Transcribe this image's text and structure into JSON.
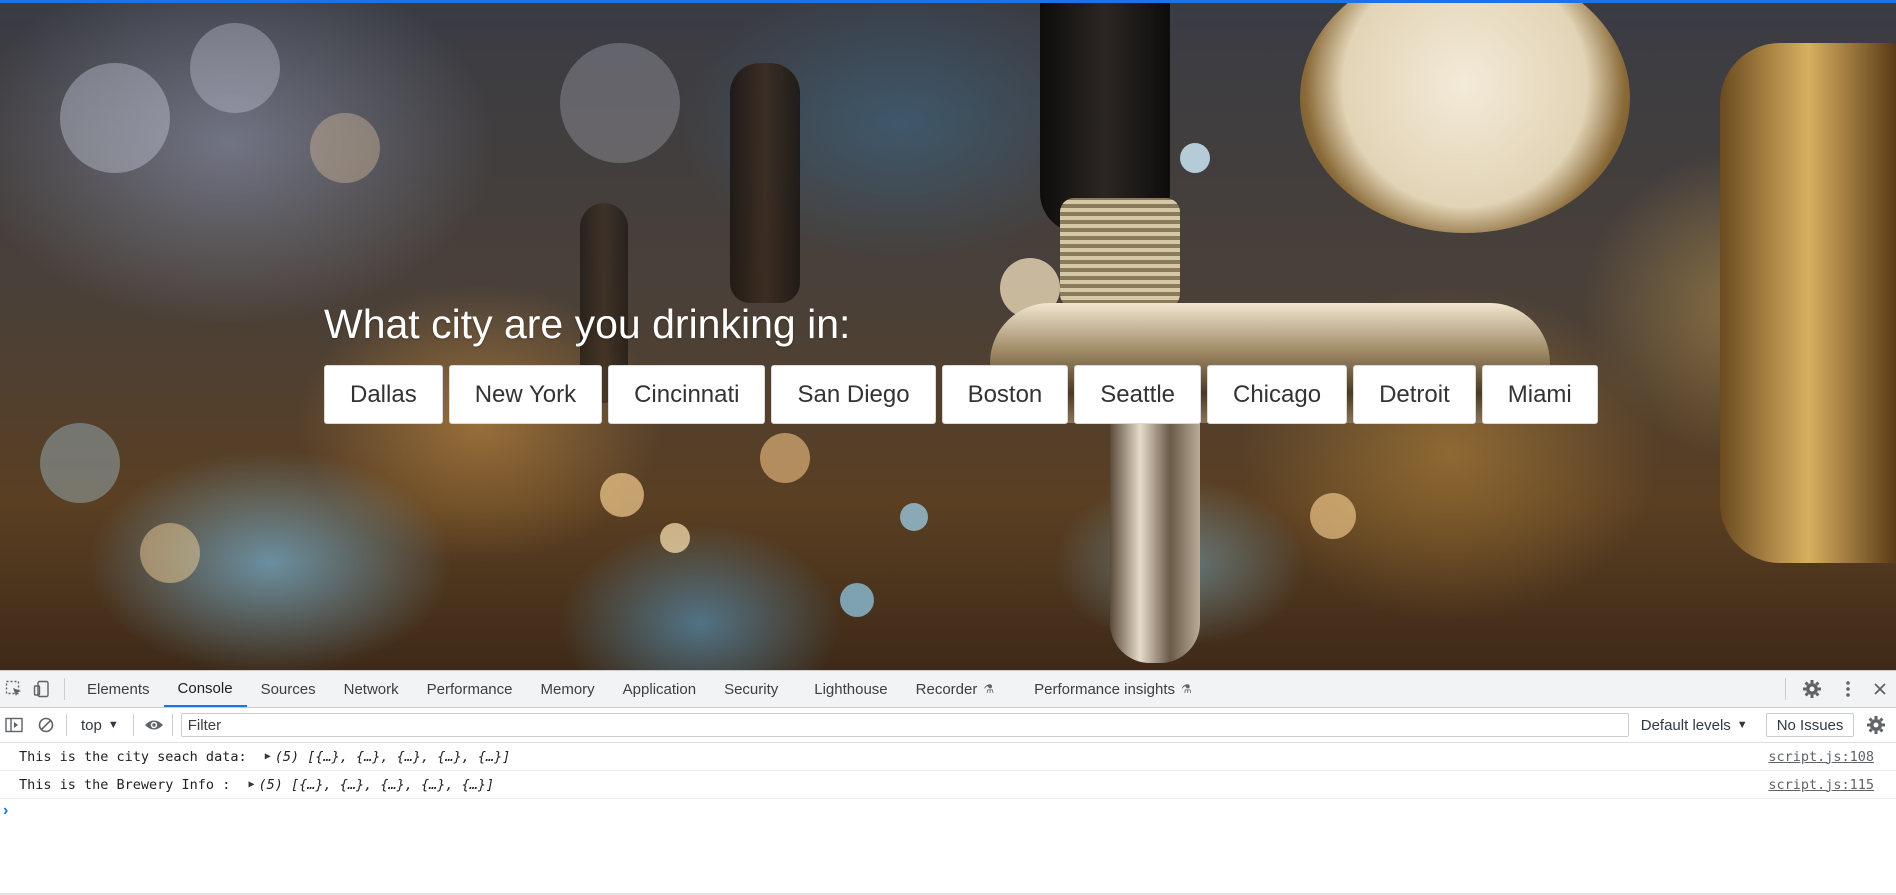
{
  "page": {
    "heading": "What city are you drinking in:",
    "cities": [
      "Dallas",
      "New York",
      "Cincinnati",
      "San Diego",
      "Boston",
      "Seattle",
      "Chicago",
      "Detroit",
      "Miami"
    ]
  },
  "devtools": {
    "tabs": [
      "Elements",
      "Console",
      "Sources",
      "Network",
      "Performance",
      "Memory",
      "Application",
      "Security",
      "Lighthouse",
      "Recorder",
      "Performance insights"
    ],
    "active_tab": "Console",
    "toolbar": {
      "context": "top",
      "filter_placeholder": "Filter",
      "levels": "Default levels",
      "issues": "No Issues"
    },
    "console": [
      {
        "message": "This is the city seach data: ",
        "value": "(5) [{…}, {…}, {…}, {…}, {…}]",
        "source": "script.js:108"
      },
      {
        "message": "This is the Brewery Info : ",
        "value": "(5) [{…}, {…}, {…}, {…}, {…}]",
        "source": "script.js:115"
      }
    ],
    "prompt": "›"
  },
  "icons": [
    "inspect-element-icon",
    "device-toolbar-icon",
    "settings-gear-icon",
    "more-vert-icon",
    "close-icon",
    "sidebar-toggle-icon",
    "clear-console-icon",
    "eye-icon",
    "experimental-flask-icon"
  ],
  "colors": {
    "accent": "#1a73e8",
    "button_bg": "#ffffff",
    "heading_text": "#ffffff"
  }
}
